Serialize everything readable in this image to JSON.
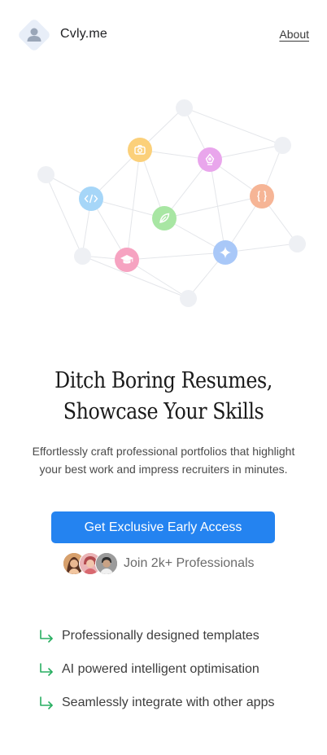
{
  "header": {
    "brand": "Cvly.me",
    "about_label": "About"
  },
  "hero": {
    "headline_line1": "Ditch Boring Resumes,",
    "headline_line2": "Showcase Your Skills",
    "subtext_line1": "Effortlessly craft professional portfolios that highlight",
    "subtext_line2": "your best work and impress recruiters in minutes.",
    "cta_label": "Get Exclusive Early Access",
    "social_proof": "Join 2k+ Professionals"
  },
  "features": [
    {
      "label": "Professionally designed templates"
    },
    {
      "label": "AI powered intelligent optimisation"
    },
    {
      "label": "Seamlessly integrate with other apps"
    }
  ],
  "network_icons": [
    "camera-icon",
    "pen-nib-icon",
    "code-icon",
    "leaf-icon",
    "curly-braces-icon",
    "graduation-cap-icon",
    "sparkle-icon"
  ],
  "colors": {
    "accent": "#2483f0",
    "camera": "#fbd07a",
    "pen": "#e9a6ec",
    "code": "#a6d6f8",
    "leaf": "#a8e6a3",
    "braces": "#f6b596",
    "cap": "#f6a3c1",
    "sparkle": "#a9c8f8",
    "check": "#27ae60"
  }
}
